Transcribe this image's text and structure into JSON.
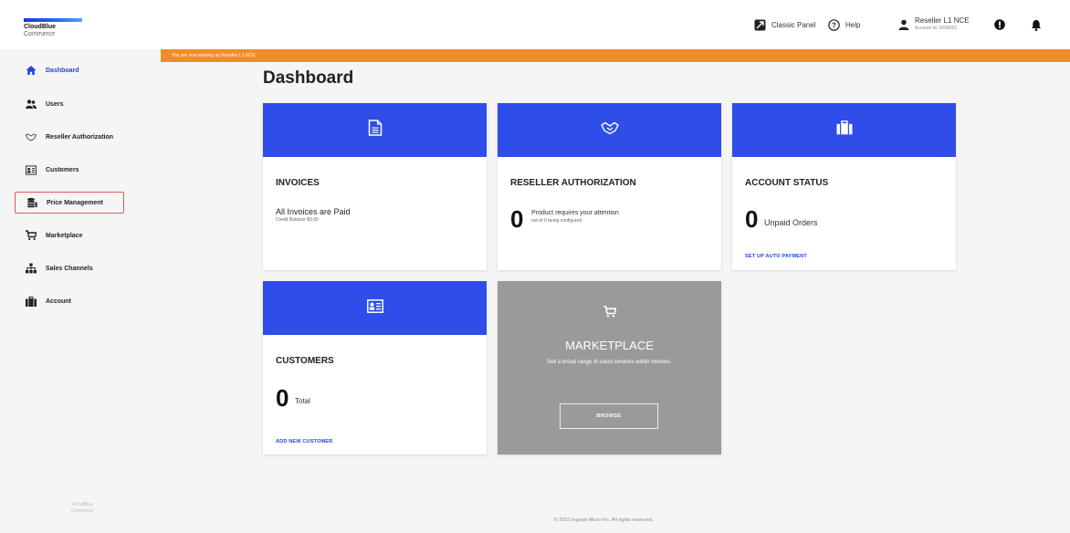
{
  "brand": {
    "line1": "CloudBlue",
    "line2": "Commerce"
  },
  "topnav": {
    "classic_panel": "Classic Panel",
    "help": "Help",
    "user_name": "Reseller L1 NCE",
    "user_account": "Account Id: 1000016"
  },
  "banner": "You are now working as Reseller L1 NCE",
  "sidebar": {
    "items": [
      {
        "label": "Dashboard",
        "icon": "home-icon"
      },
      {
        "label": "Users",
        "icon": "users-icon"
      },
      {
        "label": "Reseller Authorization",
        "icon": "handshake-icon"
      },
      {
        "label": "Customers",
        "icon": "contact-card-icon"
      },
      {
        "label": "Price Management",
        "icon": "coins-icon"
      },
      {
        "label": "Marketplace",
        "icon": "cart-icon"
      },
      {
        "label": "Sales Channels",
        "icon": "org-chart-icon"
      },
      {
        "label": "Account",
        "icon": "briefcase-icon"
      }
    ],
    "footer_line1": "CloudBlue",
    "footer_line2": "Commerce"
  },
  "main": {
    "title": "Dashboard",
    "invoices": {
      "title": "INVOICES",
      "status": "All Invoices are Paid",
      "balance": "Credit Balance $0.00"
    },
    "reseller_auth": {
      "title": "RESELLER AUTHORIZATION",
      "count": "0",
      "text": "Product requires your attention",
      "sub": "out of 0 being configured"
    },
    "account_status": {
      "title": "ACCOUNT STATUS",
      "count": "0",
      "text": "Unpaid Orders",
      "link": "SET UP AUTO PAYMENT"
    },
    "customers": {
      "title": "CUSTOMERS",
      "count": "0",
      "text": "Total",
      "link": "ADD NEW CUSTOMER"
    },
    "marketplace": {
      "title": "MARKETPLACE",
      "desc": "Sell a broad range of cloud services within minutes.",
      "button": "BROWSE"
    }
  },
  "footer": "© 2021 Ingram Micro Inc. All rights reserved.",
  "colors": {
    "accent": "#2f4de8",
    "banner": "#f28c28",
    "link": "#2044e8",
    "highlight_border": "#e05a5a",
    "marketplace_bg": "#9a9a9a"
  }
}
